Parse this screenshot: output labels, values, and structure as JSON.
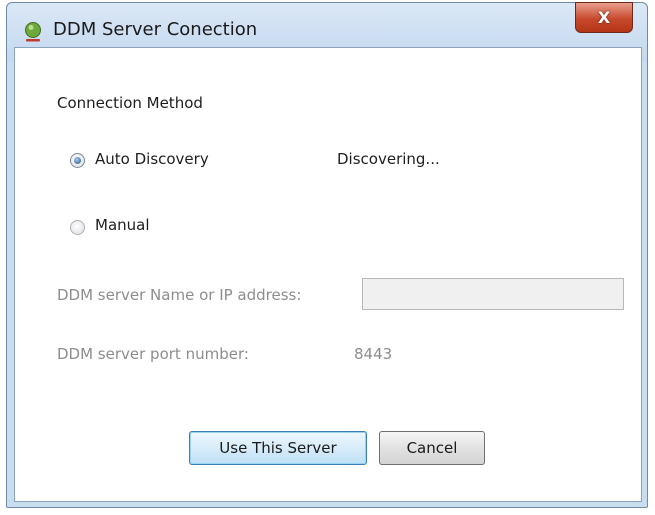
{
  "window": {
    "title": "DDM Server Conection",
    "close_label": "X"
  },
  "dialog": {
    "section_label": "Connection Method",
    "auto_discovery": {
      "label": "Auto Discovery",
      "checked": true,
      "status": "Discovering..."
    },
    "manual": {
      "label": "Manual",
      "checked": false
    },
    "server_name": {
      "label": "DDM server Name or IP address:",
      "value": ""
    },
    "port": {
      "label": "DDM server port number:",
      "value": "8443"
    },
    "buttons": {
      "use_server": "Use This Server",
      "cancel": "Cancel"
    }
  },
  "colors": {
    "titlebar": "#c9ddf1",
    "close_button": "#c8492d",
    "disabled_text": "#8d8d8d",
    "default_button_border": "#3c7fb1"
  }
}
